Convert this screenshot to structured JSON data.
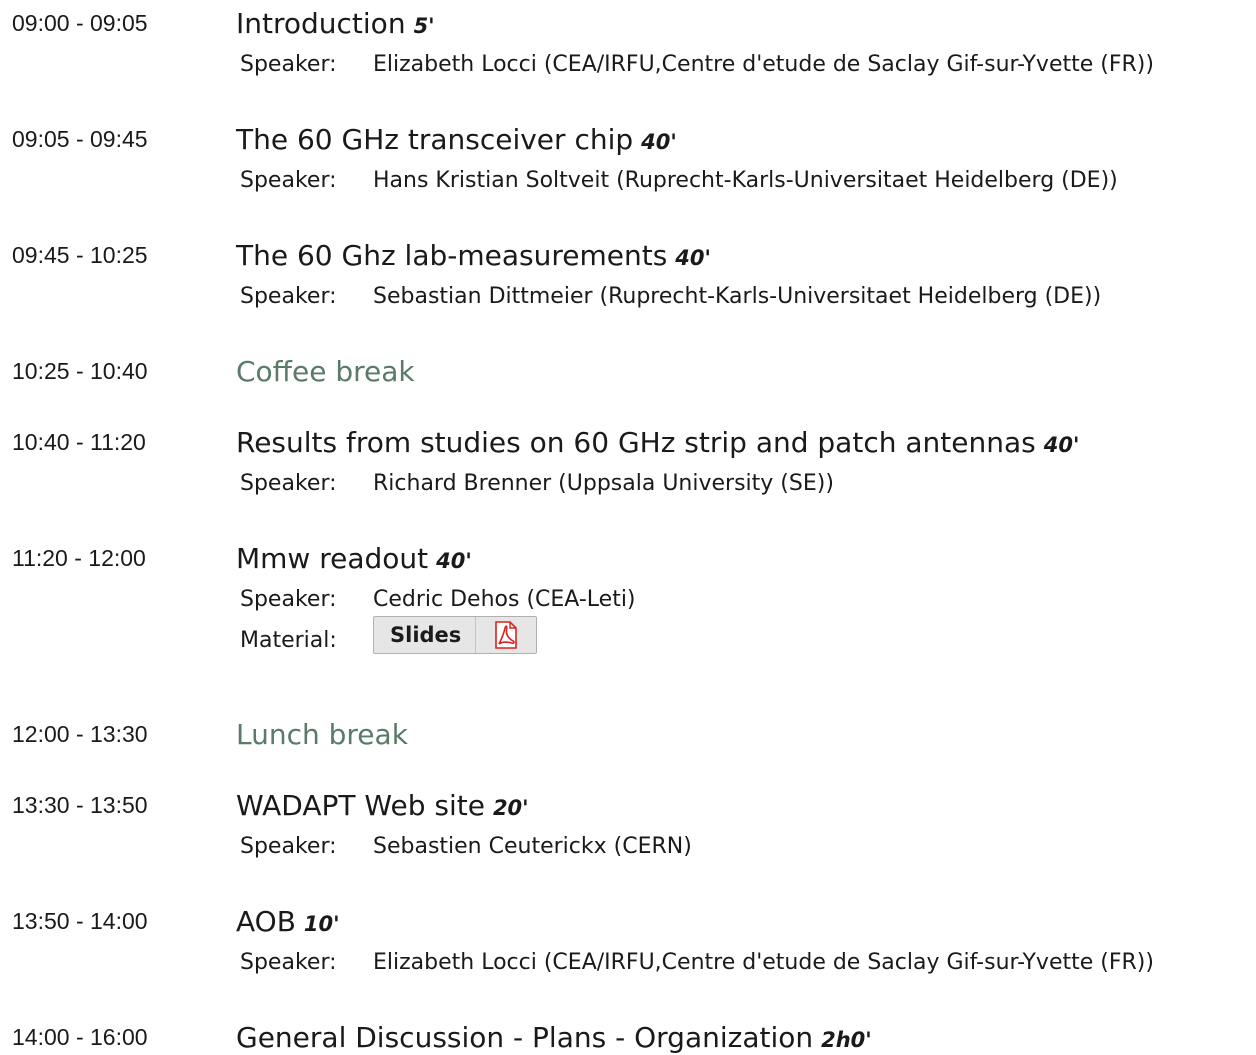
{
  "speaker_label": "Speaker:",
  "material_label": "Material:",
  "colors": {
    "text": "#1a1a1a",
    "break_title": "#5a7a6a",
    "button_bg": "#e6e6e6",
    "pdf_red": "#d9231f"
  },
  "entries": [
    {
      "time": "09:00 - 09:05",
      "title": "Introduction",
      "duration": "5'",
      "speaker": "Elizabeth Locci (CEA/IRFU,Centre d'etude de Saclay Gif-sur-Yvette (FR))"
    },
    {
      "time": "09:05 - 09:45",
      "title": "The 60 GHz transceiver chip",
      "duration": "40'",
      "speaker": "Hans Kristian Soltveit (Ruprecht-Karls-Universitaet Heidelberg (DE))"
    },
    {
      "time": "09:45 - 10:25",
      "title": "The 60 Ghz lab-measurements",
      "duration": "40'",
      "speaker": "Sebastian Dittmeier (Ruprecht-Karls-Universitaet Heidelberg (DE))"
    },
    {
      "time": "10:25 - 10:40",
      "title": "Coffee break"
    },
    {
      "time": "10:40 - 11:20",
      "title": "Results from studies on 60 GHz strip and patch antennas",
      "duration": "40'",
      "speaker": "Richard Brenner (Uppsala University (SE))"
    },
    {
      "time": "11:20 - 12:00",
      "title": "Mmw readout",
      "duration": "40'",
      "speaker": "Cedric Dehos (CEA-Leti)",
      "material": {
        "label": "Slides",
        "icon": "pdf-icon"
      }
    },
    {
      "time": "12:00 - 13:30",
      "title": "Lunch break"
    },
    {
      "time": "13:30 - 13:50",
      "title": "WADAPT Web site",
      "duration": "20'",
      "speaker": "Sebastien Ceuterickx (CERN)"
    },
    {
      "time": "13:50 - 14:00",
      "title": "AOB",
      "duration": "10'",
      "speaker": "Elizabeth Locci (CEA/IRFU,Centre d'etude de Saclay Gif-sur-Yvette (FR))"
    },
    {
      "time": "14:00 - 16:00",
      "title": "General Discussion - Plans - Organization",
      "duration": "2h0'"
    }
  ]
}
